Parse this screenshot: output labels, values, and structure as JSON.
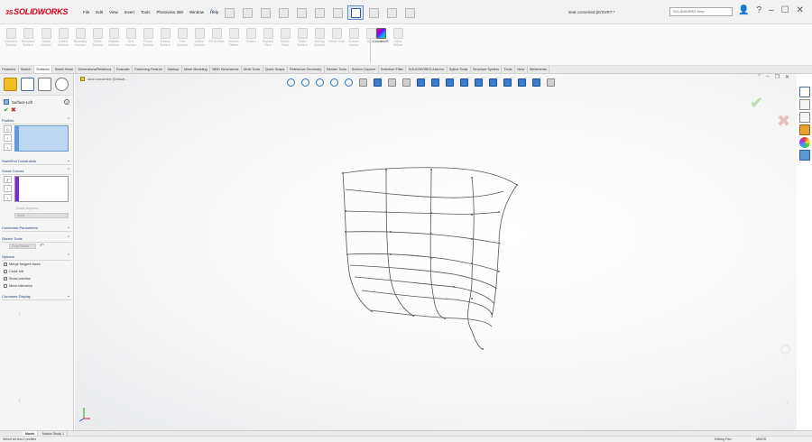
{
  "app": {
    "logo": "SOLIDWORKS",
    "document_title": "seat converted (E/SVRT *",
    "search_placeholder": "SOLIDWORKS Help"
  },
  "menu": [
    "File",
    "Edit",
    "View",
    "Insert",
    "Tools",
    "Photoview 360",
    "Window",
    "Help"
  ],
  "commands": [
    {
      "label": "Extruded Surface",
      "active": false
    },
    {
      "label": "Revolved Surface",
      "active": false
    },
    {
      "label": "Swept Surface",
      "active": false
    },
    {
      "label": "Lofted Surface",
      "active": false
    },
    {
      "label": "Boundary Surface",
      "active": false
    },
    {
      "label": "Offset Surface",
      "active": false
    },
    {
      "label": "Radiate Surface",
      "active": false
    },
    {
      "label": "Knit Surface",
      "active": false
    },
    {
      "label": "Planar Surface",
      "active": false
    },
    {
      "label": "Extend Surface",
      "active": false
    },
    {
      "label": "Trim Surface",
      "active": false
    },
    {
      "label": "Untrim Surface",
      "active": false
    },
    {
      "label": "Fill Surface",
      "active": false
    },
    {
      "label": "Surface Flatten",
      "active": false
    },
    {
      "label": "Thicken",
      "active": false
    },
    {
      "label": "Replace Face",
      "active": false
    },
    {
      "label": "Delete Face",
      "active": false
    },
    {
      "label": "Ruled Surface",
      "active": false
    },
    {
      "label": "Moving Surface",
      "active": false
    },
    {
      "label": "Delete Hole",
      "active": false
    },
    {
      "label": "Surface Library",
      "active": false
    },
    {
      "label": "Mirror",
      "active": false
    },
    {
      "label": "CurvatureS",
      "active": true
    },
    {
      "label": "Zebra Stripes",
      "active": false
    }
  ],
  "tabs": [
    "Features",
    "Sketch",
    "Surfaces",
    "Sheet Metal",
    "Dimensions/Relations",
    "Evaluate",
    "Fastening Feature",
    "Markup",
    "Mesh Modeling",
    "MBD Dimensions",
    "Mold Tools",
    "Quick Snaps",
    "Reference Geometry",
    "Render Tools",
    "Screen Capture",
    "Selection Filter",
    "SOLIDWORKS Add-Ins",
    "Spline Tools",
    "Structure System",
    "Tools",
    "View",
    "Weldments"
  ],
  "active_tab": "Surfaces",
  "property_manager": {
    "feature_title": "Surface-Loft",
    "help": "?",
    "ok": "✔",
    "cancel": "✖",
    "sections": {
      "profiles": "Profiles",
      "start_end": "Start/End Constraints",
      "guide_curves": "Guide Curves",
      "guide_influence": "Guide tangency",
      "guide_influence_value": "None",
      "centerline": "Centerline Parameters",
      "sketch_tools": "Sketch Tools",
      "drag_sketch": "Drag Sketch",
      "options": "Options",
      "curvature_display": "Curvature Display"
    },
    "options": [
      {
        "label": "Merge tangent faces",
        "checked": true
      },
      {
        "label": "Close loft",
        "checked": false
      },
      {
        "label": "Show preview",
        "checked": true
      },
      {
        "label": "Micro tolerance",
        "checked": false
      }
    ]
  },
  "graphics": {
    "breadcrumb": "seat converted (Default..."
  },
  "bottom_tabs": [
    "Model",
    "Motion Study 1"
  ],
  "status": {
    "left": "Select all and 2 profiles",
    "mode": "Editing Part",
    "units": "MMGS"
  },
  "colors": {
    "accent": "#d5001c",
    "profile_bar": "#5f9be0",
    "guide_bar": "#7a2ad0"
  }
}
